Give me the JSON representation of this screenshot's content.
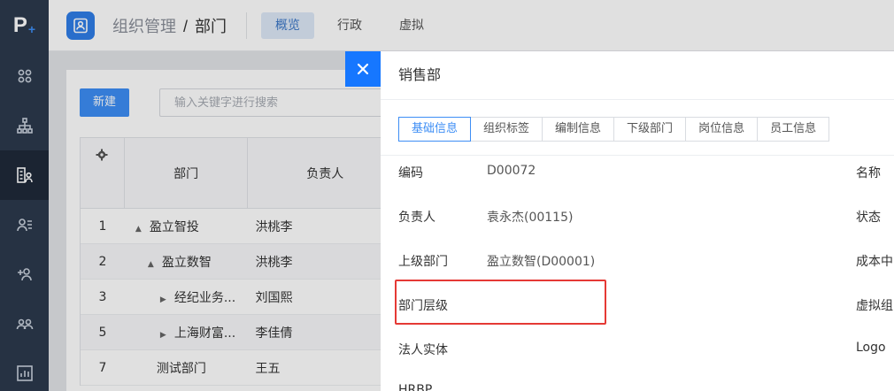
{
  "rail": {
    "logo": "P",
    "logo_plus": "+",
    "items": [
      {
        "icon": "grid-icon"
      },
      {
        "icon": "org-tree-icon"
      },
      {
        "icon": "building-user-icon",
        "active": true
      },
      {
        "icon": "staff-list-icon"
      },
      {
        "icon": "add-user-icon"
      },
      {
        "icon": "group-icon"
      },
      {
        "icon": "chart-icon"
      }
    ]
  },
  "header": {
    "breadcrumb_parent": "组织管理",
    "breadcrumb_sep": "/",
    "breadcrumb_current": "部门",
    "tabs": [
      {
        "label": "概览",
        "active": true
      },
      {
        "label": "行政"
      },
      {
        "label": "虚拟"
      }
    ]
  },
  "list": {
    "new_button": "新建",
    "search_placeholder": "输入关键字进行搜索",
    "columns": [
      "部门",
      "负责人"
    ],
    "rows": [
      {
        "no": "1",
        "indent": 0,
        "expander": "▲",
        "dept": "盈立智投",
        "owner": "洪桃李"
      },
      {
        "no": "2",
        "indent": 1,
        "expander": "▲",
        "dept": "盈立数智",
        "owner": "洪桃李"
      },
      {
        "no": "3",
        "indent": 2,
        "expander": "▶",
        "dept": "经纪业务...",
        "owner": "刘国熙"
      },
      {
        "no": "5",
        "indent": 2,
        "expander": "▶",
        "dept": "上海财富...",
        "owner": "李佳倩"
      },
      {
        "no": "7",
        "indent": 1,
        "expander": "",
        "dept": "测试部门",
        "owner": "王五"
      }
    ]
  },
  "drawer": {
    "close_icon": "close-icon",
    "title": "销售部",
    "tabs": [
      {
        "label": "基础信息",
        "active": true
      },
      {
        "label": "组织标签"
      },
      {
        "label": "编制信息"
      },
      {
        "label": "下级部门"
      },
      {
        "label": "岗位信息"
      },
      {
        "label": "员工信息"
      }
    ],
    "fields": {
      "code_label": "编码",
      "code_value": "D00072",
      "owner_label": "负责人",
      "owner_value": "袁永杰(00115)",
      "parent_label": "上级部门",
      "parent_value": "盈立数智(D00001)",
      "level_label": "部门层级",
      "legal_label": "法人实体",
      "hrbp_label": "HRBP"
    },
    "right_labels": {
      "name": "名称",
      "status": "状态",
      "cost": "成本中",
      "virtual": "虚拟组",
      "logo": "Logo"
    }
  },
  "colors": {
    "rail_bg": "#2c3a4d",
    "accent": "#3d8ef5",
    "close_bg": "#1677ff",
    "highlight": "#e53935"
  }
}
